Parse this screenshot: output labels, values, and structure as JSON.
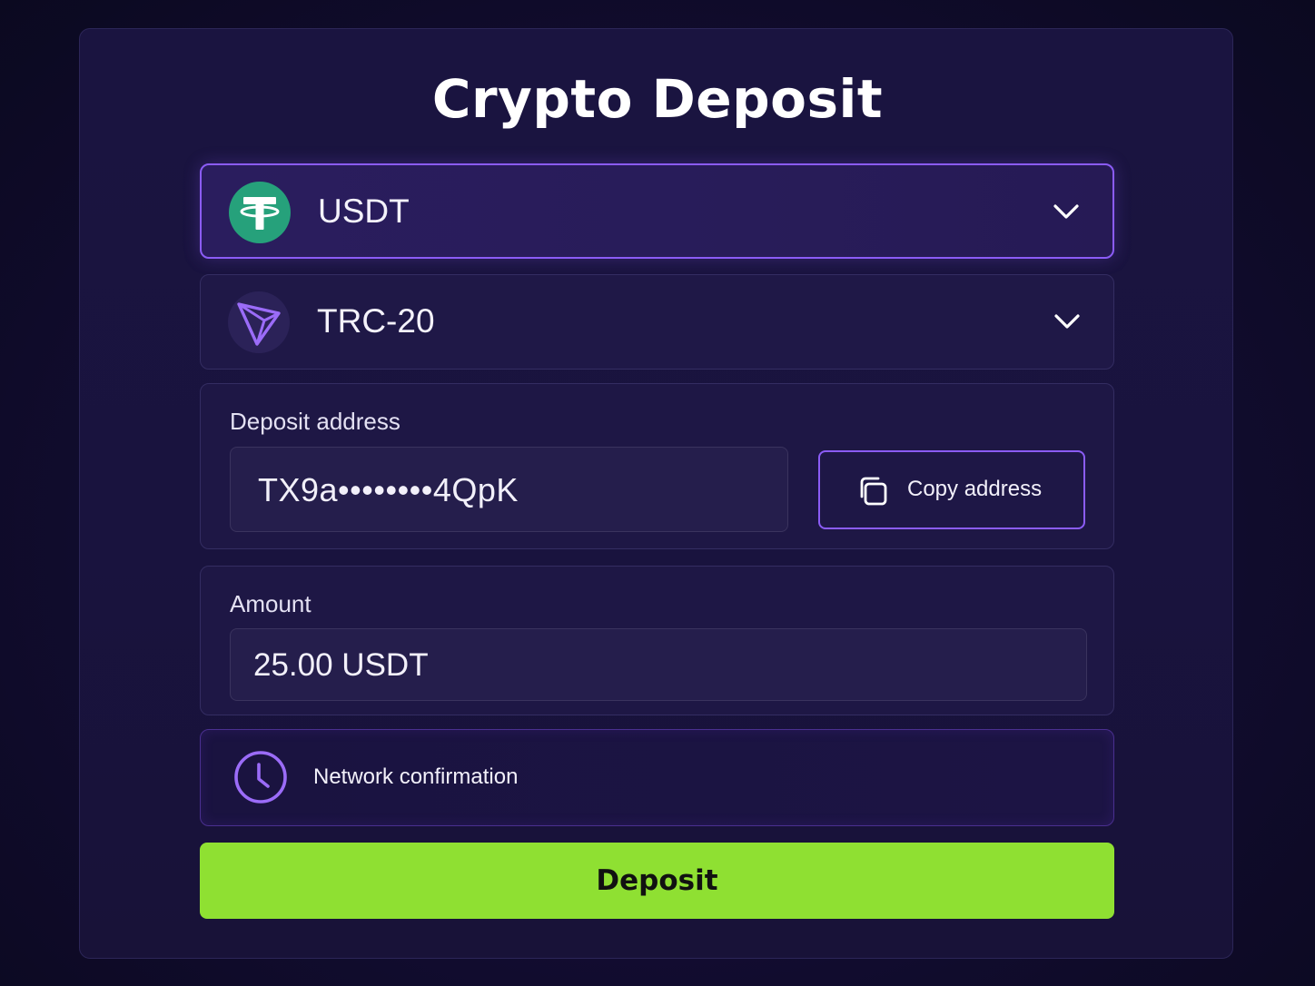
{
  "title": "Crypto Deposit",
  "token_select": {
    "value": "USDT",
    "icon": "usdt-tether-icon",
    "icon_color": "#26a17b"
  },
  "network_select": {
    "value": "TRC-20",
    "icon": "tron-icon",
    "icon_color": "#8b5cf6"
  },
  "deposit_address": {
    "label": "Deposit address",
    "value": "TX9a••••••••4QpK",
    "copy_button_label": "Copy address"
  },
  "amount": {
    "label": "Amount",
    "value": "25.00 USDT"
  },
  "status": {
    "label": "Network confirmation",
    "icon": "clock-icon"
  },
  "deposit_button": {
    "label": "Deposit",
    "color": "#8fe032"
  },
  "colors": {
    "accent": "#8b5cf6",
    "background": "#130d33"
  }
}
